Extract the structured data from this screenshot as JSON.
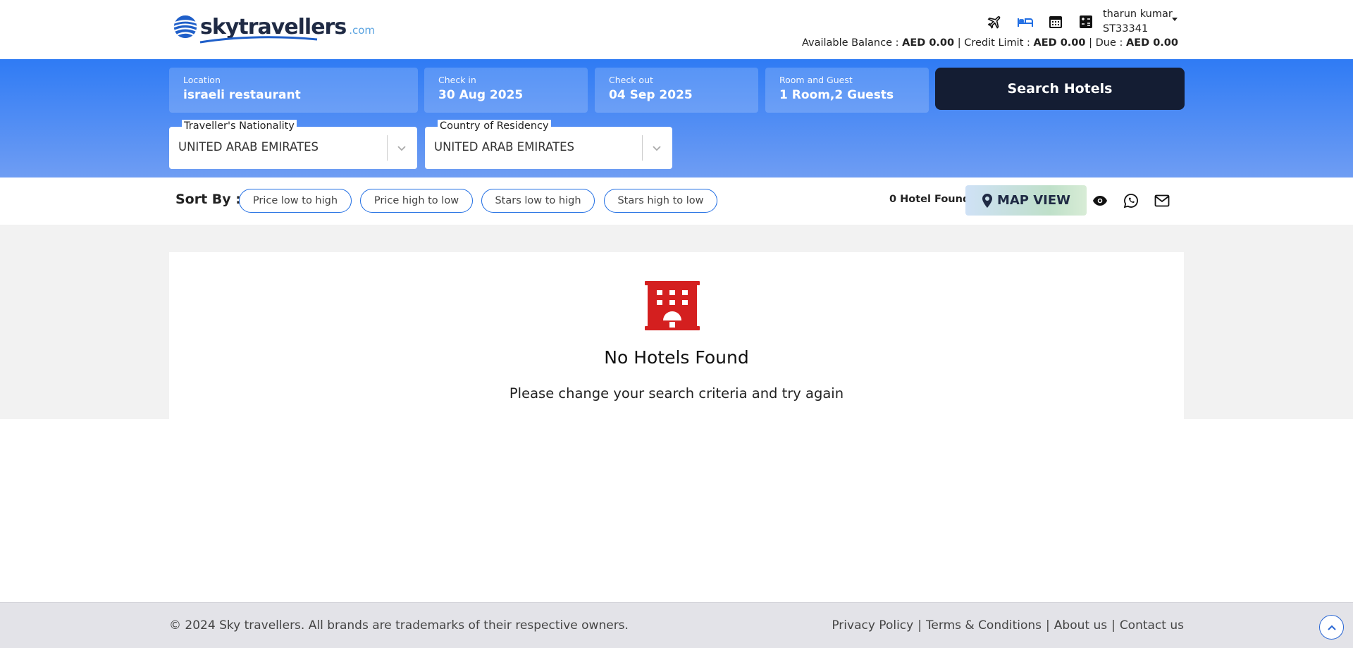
{
  "header": {
    "logo_text": "skytravellers",
    "logo_suffix": ".com",
    "icons": [
      "flight-icon",
      "hotel-icon",
      "calendar-icon",
      "calculator-icon"
    ],
    "user_name": "tharun kumar",
    "user_id": "ST33341",
    "balance": {
      "available_label": "Available Balance :",
      "available_value": "AED 0.00",
      "credit_label": "Credit Limit :",
      "credit_value": "AED 0.00",
      "due_label": "Due :",
      "due_value": "AED 0.00"
    }
  },
  "search": {
    "location_label": "Location",
    "location_value": "israeli restaurant",
    "checkin_label": "Check in",
    "checkin_value": "30 Aug 2025",
    "checkout_label": "Check out",
    "checkout_value": "04 Sep 2025",
    "rooms_label": "Room and Guest",
    "rooms_value": "1 Room,2 Guests",
    "search_button": "Search Hotels",
    "nationality_label": "Traveller's Nationality",
    "nationality_value": "UNITED ARAB EMIRATES",
    "residency_label": "Country of Residency",
    "residency_value": "UNITED ARAB EMIRATES"
  },
  "sort": {
    "label": "Sort By :",
    "options": [
      "Price low to high",
      "Price high to low",
      "Stars low to high",
      "Stars high to low"
    ],
    "found": "0 Hotel Found",
    "map_view": "MAP VIEW"
  },
  "results": {
    "title": "No Hotels Found",
    "subtitle": "Please change your search criteria and try again"
  },
  "footer": {
    "copyright": "© 2024 Sky travellers. All brands are trademarks of their respective owners.",
    "links": [
      "Privacy Policy",
      "Terms & Conditions",
      "About us",
      "Contact us"
    ],
    "separator": "|"
  },
  "colors": {
    "accent": "#1f6de3",
    "band_top": "#2f7bf4",
    "band_bottom": "#6f9df3",
    "search_button": "#141d33",
    "hotel_icon": "#d41f1f"
  }
}
